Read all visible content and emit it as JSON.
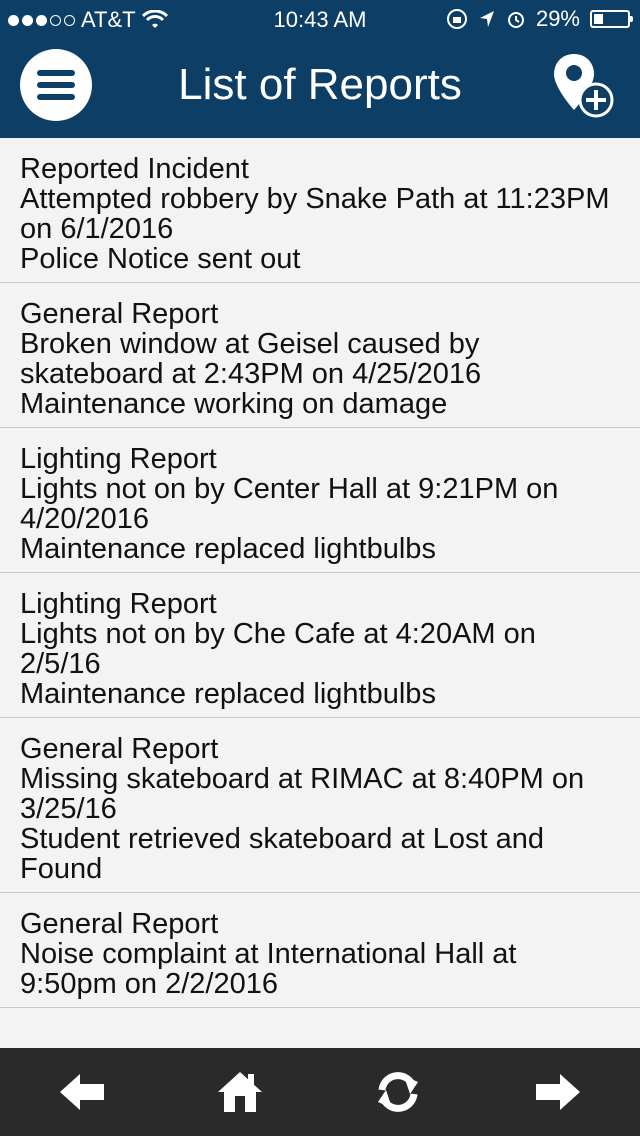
{
  "status_bar": {
    "carrier": "AT&T",
    "time": "10:43 AM",
    "battery": "29%",
    "battery_level": 0.29
  },
  "header": {
    "title": "List of Reports",
    "menu_icon": "hamburger-menu-icon",
    "add_icon": "add-location-pin-icon"
  },
  "reports": [
    {
      "type": "Reported Incident",
      "description": "Attempted robbery by Snake Path at 11:23PM on 6/1/2016",
      "status": "Police Notice sent out"
    },
    {
      "type": "General Report",
      "description": "Broken window at Geisel caused by skateboard at 2:43PM on 4/25/2016",
      "status": "Maintenance working on damage"
    },
    {
      "type": "Lighting Report",
      "description": "Lights not on by Center Hall at 9:21PM on 4/20/2016",
      "status": "Maintenance replaced lightbulbs"
    },
    {
      "type": "Lighting Report",
      "description": "Lights not on by Che Cafe at 4:20AM on 2/5/16",
      "status": "Maintenance replaced lightbulbs"
    },
    {
      "type": "General Report",
      "description": "Missing skateboard at RIMAC at 8:40PM on 3/25/16",
      "status": "Student retrieved skateboard at Lost and Found"
    },
    {
      "type": "General Report",
      "description": "Noise complaint at International Hall at 9:50pm on 2/2/2016",
      "status": ""
    }
  ],
  "tab_bar": {
    "icons": [
      "back-arrow-icon",
      "home-icon",
      "refresh-icon",
      "forward-arrow-icon"
    ]
  },
  "colors": {
    "header_bg": "#0d3f66",
    "list_bg": "#f3f3f3",
    "tab_bar_bg": "#2a2a2a"
  }
}
